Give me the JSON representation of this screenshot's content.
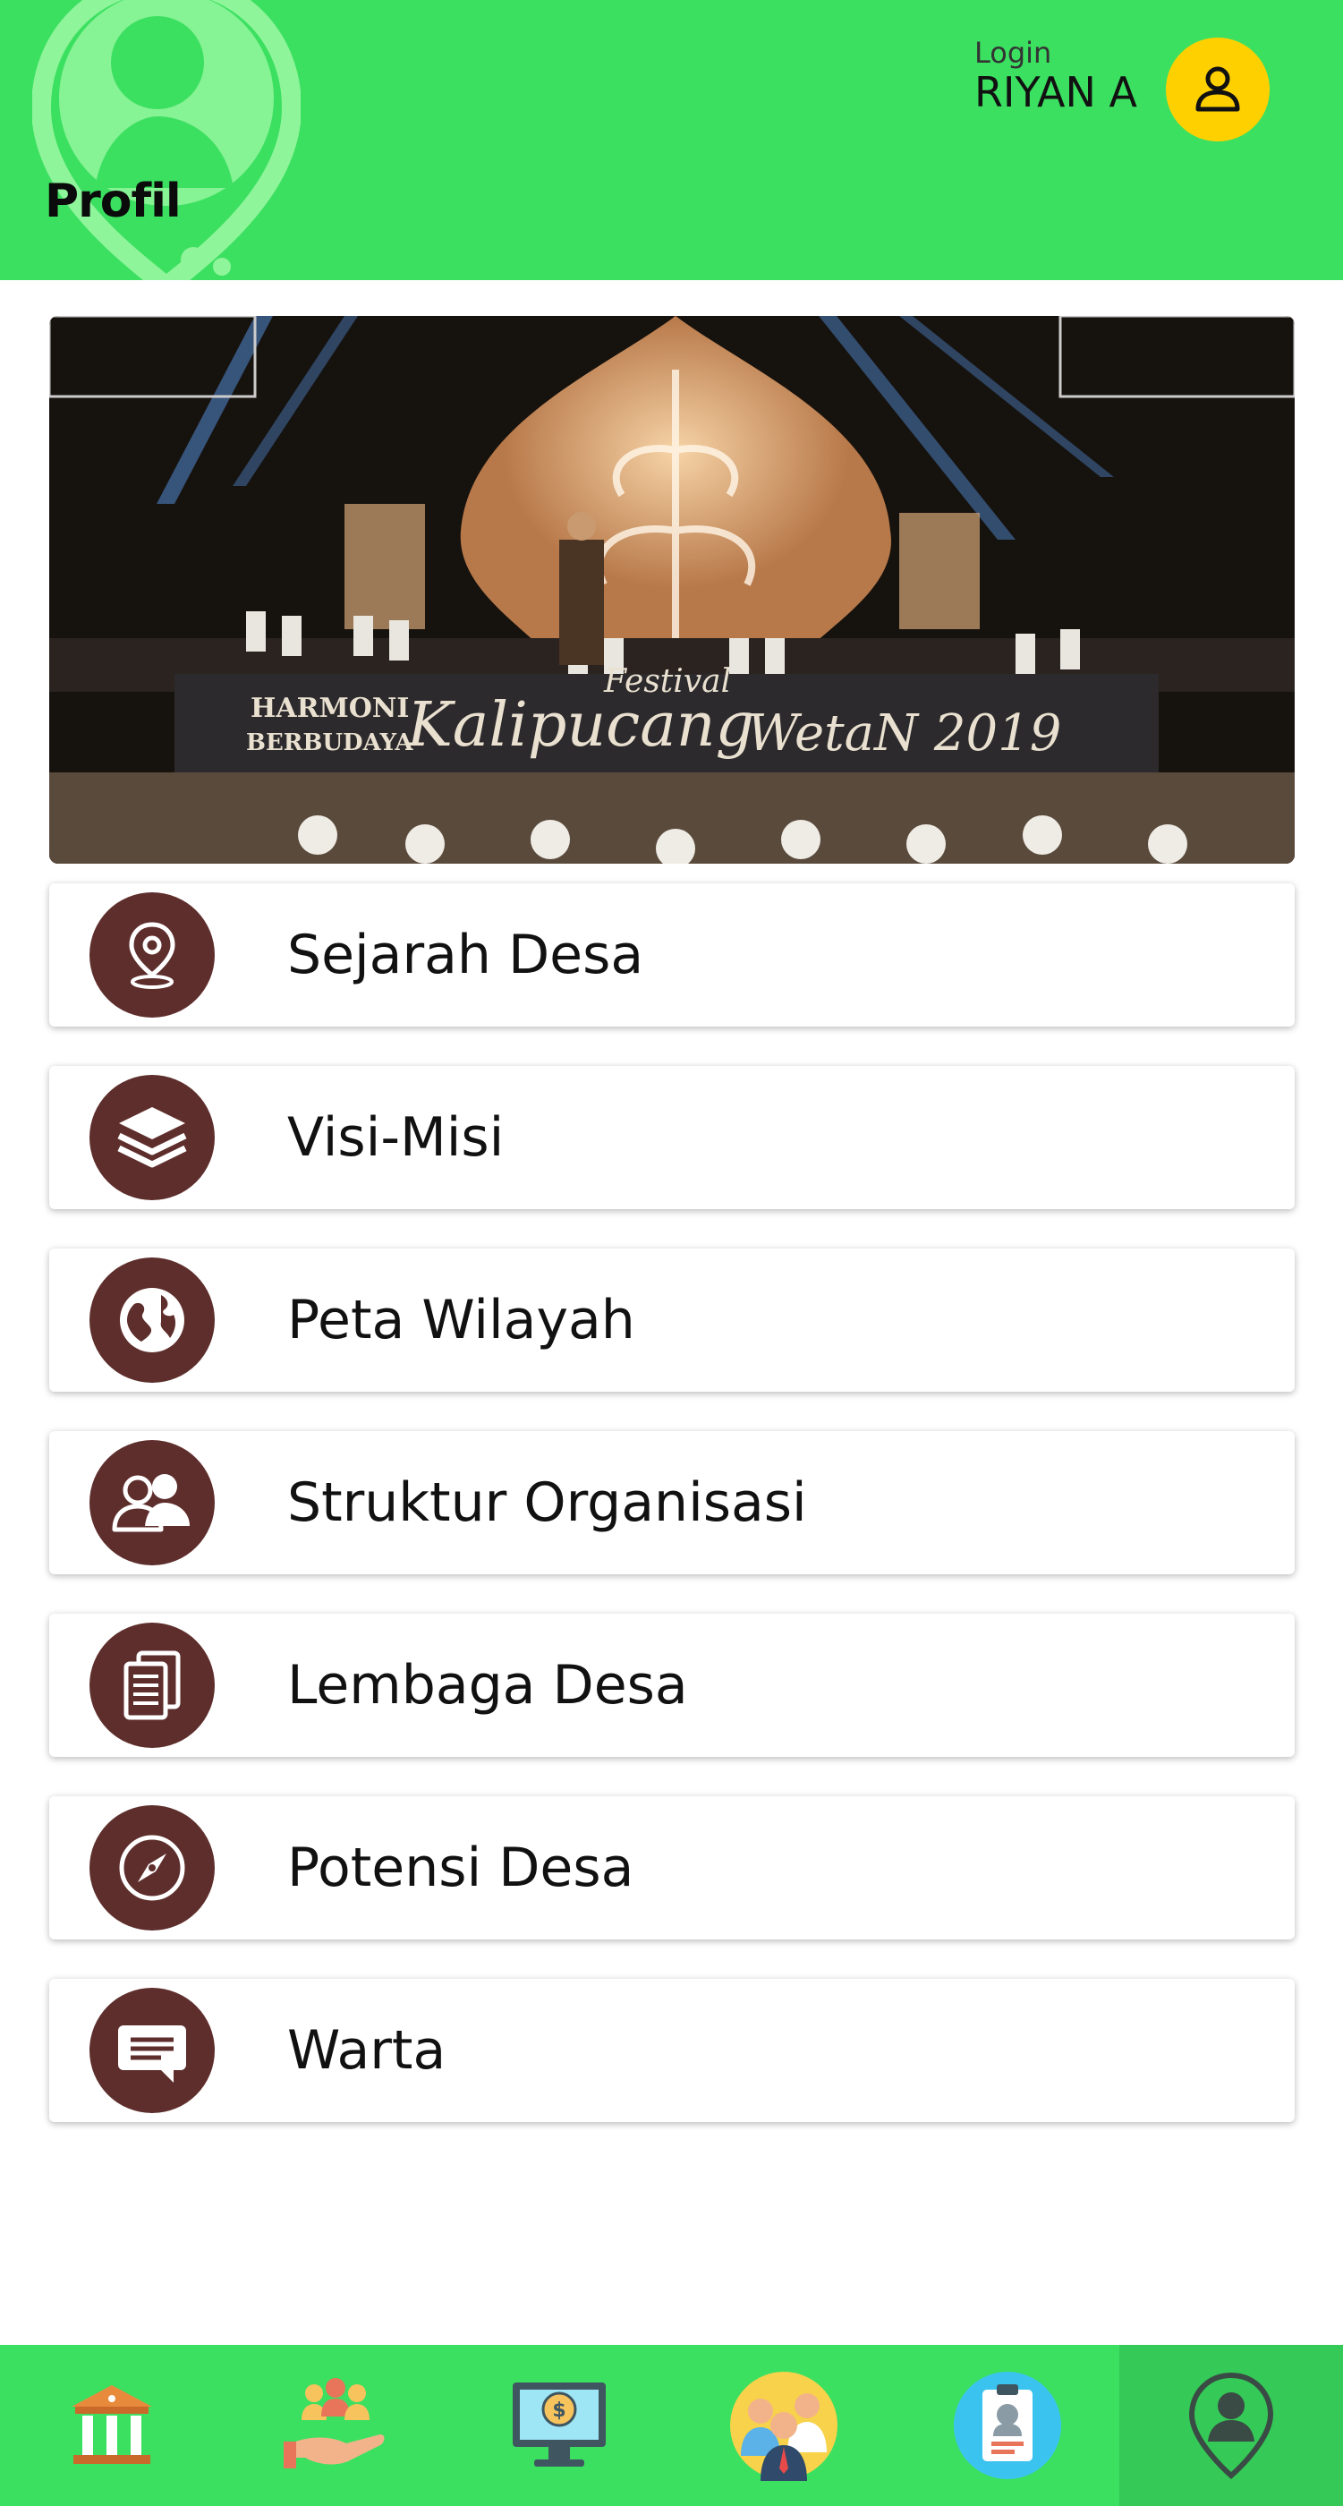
{
  "header": {
    "title": "Profil",
    "login_label": "Login",
    "user_name": "RIYAN A",
    "accent_color": "#3ce060",
    "avatar_color": "#ffd000"
  },
  "banner": {
    "image_semantic": "festival-stage-photo",
    "text_lines": [
      "HARMONI",
      "BERBUDAYA",
      "Festival",
      "Kalipucang",
      "WetaN 2019"
    ]
  },
  "menu": {
    "icon_color": "#5e2e2c",
    "items": [
      {
        "label": "Sejarah Desa",
        "icon": "location-pin-icon"
      },
      {
        "label": "Visi-Misi",
        "icon": "layers-icon"
      },
      {
        "label": "Peta Wilayah",
        "icon": "globe-icon"
      },
      {
        "label": "Struktur Organisasi",
        "icon": "people-icon"
      },
      {
        "label": "Lembaga Desa",
        "icon": "documents-icon"
      },
      {
        "label": "Potensi Desa",
        "icon": "compass-icon"
      },
      {
        "label": "Warta",
        "icon": "message-icon"
      }
    ]
  },
  "bottom_nav": {
    "items": [
      {
        "icon": "bank-building-icon",
        "active": false
      },
      {
        "icon": "community-hand-icon",
        "active": false
      },
      {
        "icon": "monitor-money-icon",
        "active": false
      },
      {
        "icon": "officials-group-icon",
        "active": false
      },
      {
        "icon": "id-card-icon",
        "active": false
      },
      {
        "icon": "profile-location-icon",
        "active": true
      }
    ]
  }
}
